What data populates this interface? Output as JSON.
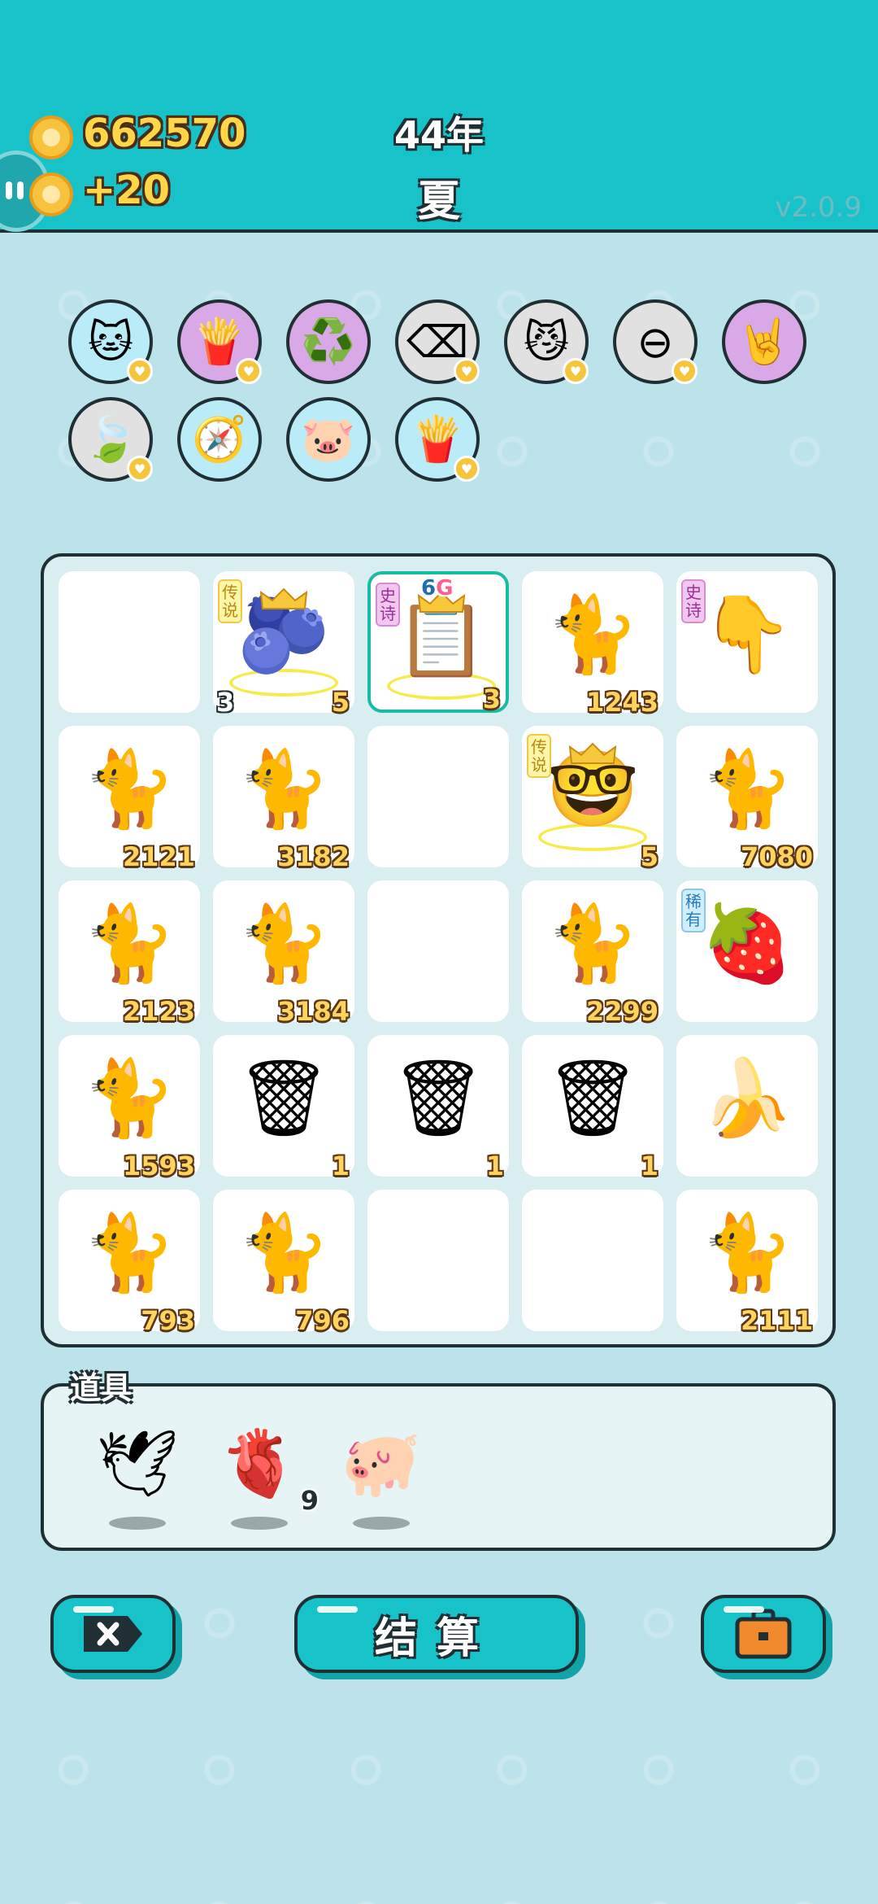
{
  "header": {
    "coins": "662570",
    "income": "+20",
    "year": "44年",
    "season": "夏",
    "version": "v2.0.9"
  },
  "tools_row1": [
    {
      "icon": "cat-portrait-icon",
      "glyph": "🐱",
      "bg": "#b9ecf7",
      "badge": true
    },
    {
      "icon": "fries-icon",
      "glyph": "🍟",
      "bg": "#d9a8e6",
      "badge": true
    },
    {
      "icon": "recycle-icon",
      "glyph": "♻️",
      "bg": "#d9a8e6",
      "badge": false
    },
    {
      "icon": "delete-tag-icon",
      "glyph": "⌫",
      "bg": "#e1e1e1",
      "badge": true
    },
    {
      "icon": "two-cats-icon",
      "glyph": "😼",
      "bg": "#e1e1e1",
      "badge": true
    },
    {
      "icon": "minus-circle-icon",
      "glyph": "⊖",
      "bg": "#e1e1e1",
      "badge": true
    },
    {
      "icon": "rock-hand-icon",
      "glyph": "🤘",
      "bg": "#d9a8e6",
      "badge": false
    }
  ],
  "tools_row2": [
    {
      "icon": "leaf-icon",
      "glyph": "🍃",
      "bg": "#e1e1e1",
      "badge": true
    },
    {
      "icon": "compass-icon",
      "glyph": "🧭",
      "bg": "#b9ecf7",
      "badge": false
    },
    {
      "icon": "piggy-bank-icon",
      "glyph": "🐷",
      "bg": "#b9ecf7",
      "badge": false
    },
    {
      "icon": "fries-icon",
      "glyph": "🍟",
      "bg": "#b9ecf7",
      "badge": true
    }
  ],
  "grid": [
    [
      {
        "icon": "",
        "count": "",
        "tag": "",
        "tagType": "",
        "lcount": ""
      },
      {
        "icon": "gourd-icon",
        "glyph": "🫐",
        "count": "5",
        "tag": "传说",
        "tagType": "leg",
        "lcount": "3",
        "crown": true
      },
      {
        "icon": "copy-paste-icon",
        "glyph": "📋",
        "count": "3",
        "tag": "史诗",
        "tagType": "epic",
        "lcount": "",
        "crown": true,
        "selected": true,
        "sizeA": "6",
        "sizeB": "G"
      },
      {
        "icon": "cat-icon",
        "glyph": "🐈",
        "count": "1243",
        "tag": "",
        "tagType": "",
        "lcount": ""
      },
      {
        "icon": "pointing-hand-icon",
        "glyph": "👇",
        "count": "",
        "tag": "史诗",
        "tagType": "epic",
        "lcount": ""
      }
    ],
    [
      {
        "icon": "cat-icon",
        "glyph": "🐈",
        "count": "2121",
        "tag": "",
        "tagType": "",
        "lcount": ""
      },
      {
        "icon": "cat-icon",
        "glyph": "🐈",
        "count": "3182",
        "tag": "",
        "tagType": "",
        "lcount": ""
      },
      {
        "icon": "",
        "count": "",
        "tag": "",
        "tagType": "",
        "lcount": ""
      },
      {
        "icon": "grinning-man-icon",
        "glyph": "🤓",
        "count": "5",
        "tag": "传说",
        "tagType": "leg",
        "lcount": "",
        "crown": true
      },
      {
        "icon": "cat-icon",
        "glyph": "🐈",
        "count": "7080",
        "tag": "",
        "tagType": "",
        "lcount": ""
      }
    ],
    [
      {
        "icon": "cat-icon",
        "glyph": "🐈",
        "count": "2123",
        "tag": "",
        "tagType": "",
        "lcount": ""
      },
      {
        "icon": "cat-icon",
        "glyph": "🐈",
        "count": "3184",
        "tag": "",
        "tagType": "",
        "lcount": ""
      },
      {
        "icon": "",
        "count": "",
        "tag": "",
        "tagType": "",
        "lcount": ""
      },
      {
        "icon": "cat-icon",
        "glyph": "🐈",
        "count": "2299",
        "tag": "",
        "tagType": "",
        "lcount": ""
      },
      {
        "icon": "lychee-icon",
        "glyph": "🍓",
        "count": "",
        "tag": "稀有",
        "tagType": "rare",
        "lcount": ""
      }
    ],
    [
      {
        "icon": "cat-icon",
        "glyph": "🐈",
        "count": "1593",
        "tag": "",
        "tagType": "",
        "lcount": ""
      },
      {
        "icon": "trash-bag-icon",
        "glyph": "🗑",
        "count": "1",
        "tag": "",
        "tagType": "",
        "lcount": ""
      },
      {
        "icon": "trash-bag-icon",
        "glyph": "🗑",
        "count": "1",
        "tag": "",
        "tagType": "",
        "lcount": ""
      },
      {
        "icon": "trash-bag-icon",
        "glyph": "🗑",
        "count": "1",
        "tag": "",
        "tagType": "",
        "lcount": ""
      },
      {
        "icon": "banana-icon",
        "glyph": "🍌",
        "count": "",
        "tag": "",
        "tagType": "",
        "lcount": ""
      }
    ],
    [
      {
        "icon": "cat-icon",
        "glyph": "🐈",
        "count": "793",
        "tag": "",
        "tagType": "",
        "lcount": ""
      },
      {
        "icon": "cat-icon",
        "glyph": "🐈",
        "count": "796",
        "tag": "",
        "tagType": "",
        "lcount": ""
      },
      {
        "icon": "",
        "count": "",
        "tag": "",
        "tagType": "",
        "lcount": ""
      },
      {
        "icon": "",
        "count": "",
        "tag": "",
        "tagType": "",
        "lcount": ""
      },
      {
        "icon": "cat-icon",
        "glyph": "🐈",
        "count": "2111",
        "tag": "",
        "tagType": "",
        "lcount": ""
      }
    ]
  ],
  "props": {
    "label": "道具",
    "items": [
      {
        "icon": "bird-icon",
        "glyph": "🕊",
        "count": ""
      },
      {
        "icon": "liver-icon",
        "glyph": "🫀",
        "count": "9"
      },
      {
        "icon": "piggy-bank-icon",
        "glyph": "🐖",
        "count": ""
      }
    ]
  },
  "buttons": {
    "settle": "结算",
    "delete_icon": "delete-tag-icon",
    "bag_icon": "briefcase-icon"
  }
}
